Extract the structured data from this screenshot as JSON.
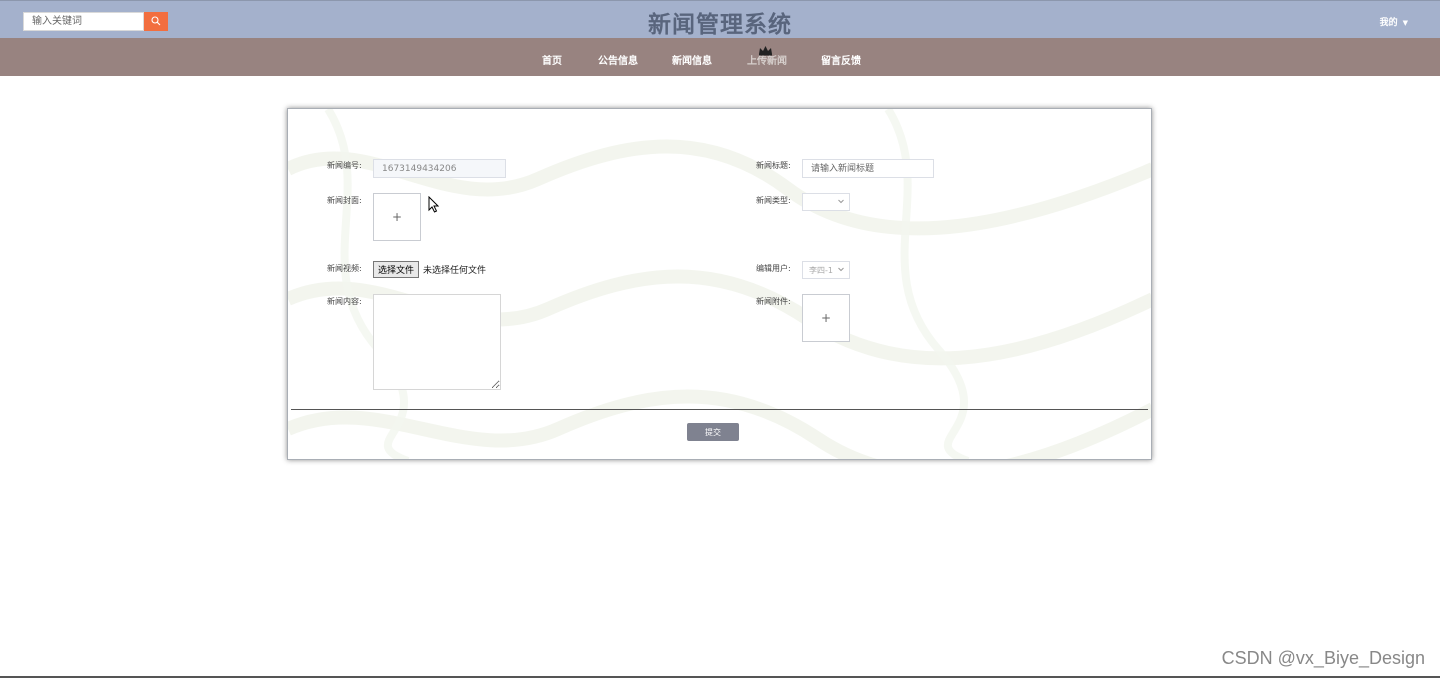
{
  "header": {
    "search_placeholder": "输入关键词",
    "title": "新闻管理系统",
    "user_menu": "我的",
    "caret": "▼"
  },
  "nav": {
    "items": [
      {
        "label": "首页"
      },
      {
        "label": "公告信息"
      },
      {
        "label": "新闻信息"
      },
      {
        "label": "上传新闻"
      },
      {
        "label": "留言反馈"
      }
    ],
    "active": "上传新闻"
  },
  "form": {
    "news_id_label": "新闻编号:",
    "news_id_value": "1673149434206",
    "news_title_label": "新闻标题:",
    "news_title_placeholder": "请输入新闻标题",
    "cover_label": "新闻封面:",
    "cover_plus": "+",
    "type_label": "新闻类型:",
    "type_value": "",
    "video_label": "新闻视频:",
    "file_button": "选择文件",
    "file_status": "未选择任何文件",
    "editor_label": "编辑用户:",
    "editor_value": "李四-1",
    "content_label": "新闻内容:",
    "attachment_label": "新闻附件:",
    "attachment_plus": "+",
    "submit_label": "提交"
  },
  "watermark": "CSDN @vx_Biye_Design",
  "colors": {
    "topbar": "#a4b1cc",
    "navbar": "#988380",
    "search_button": "#f26e3f",
    "submit_button": "#7f8290"
  }
}
